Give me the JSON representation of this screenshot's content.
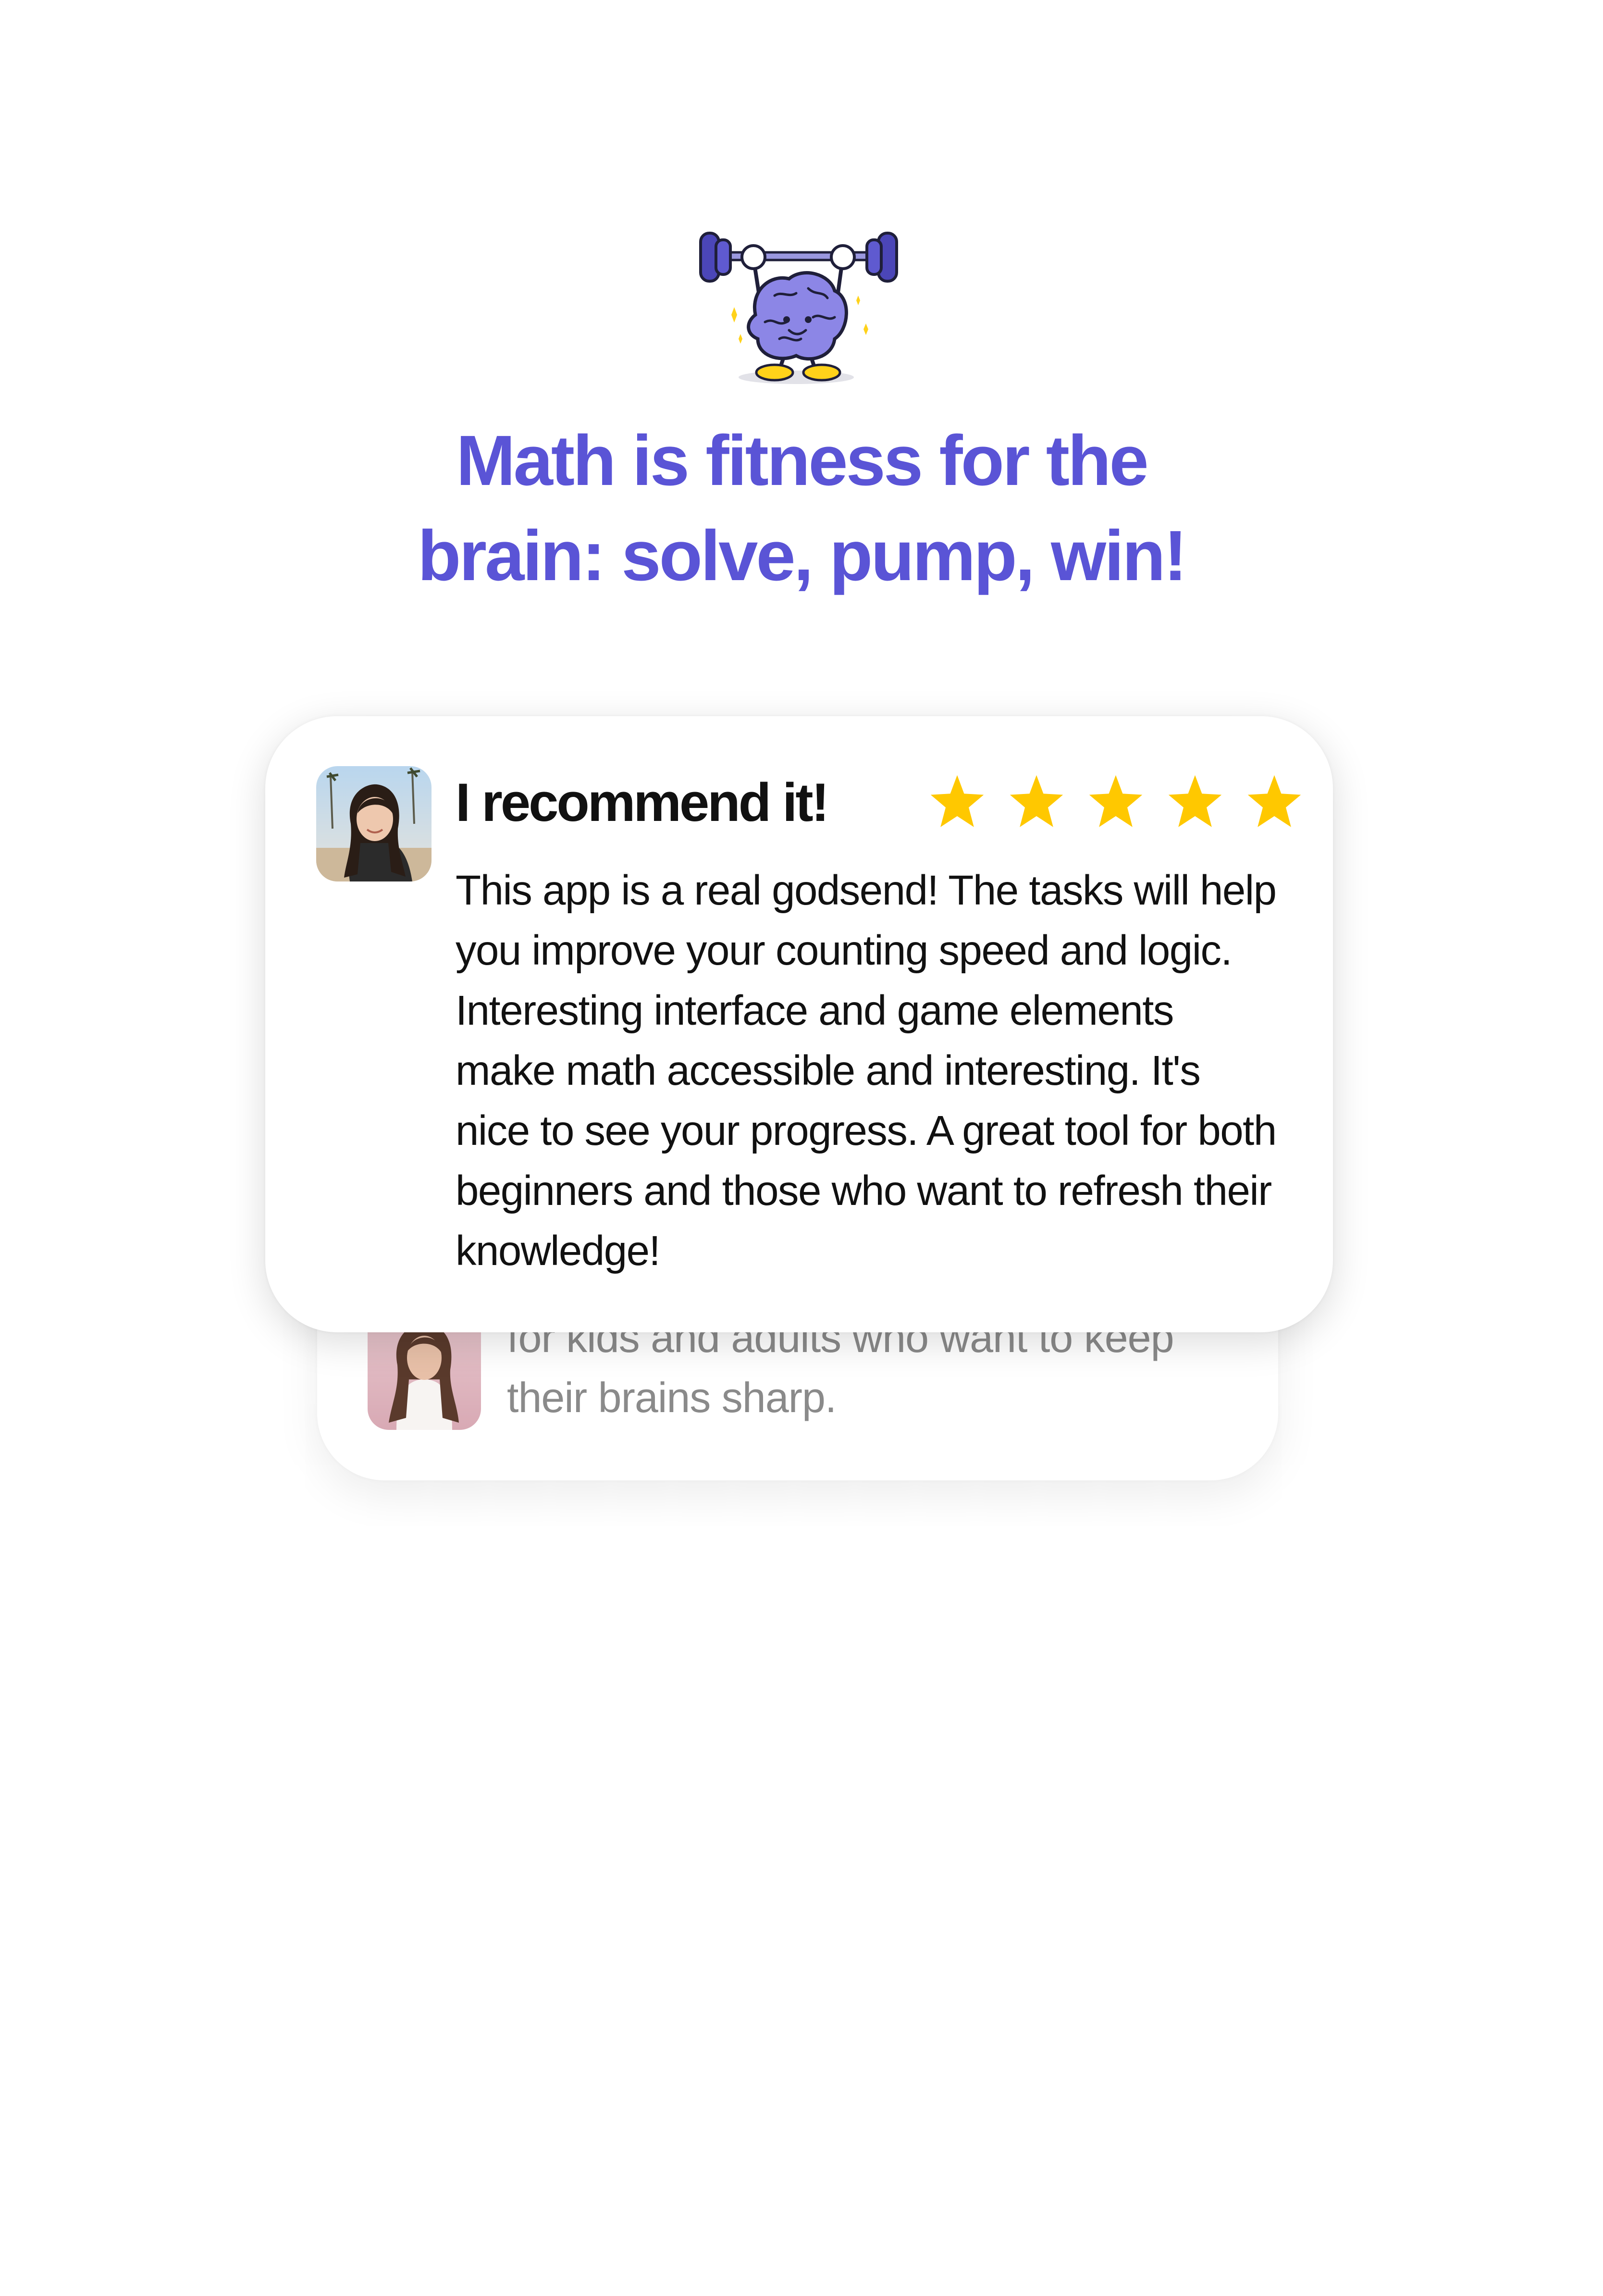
{
  "hero": {
    "mascot_icon": "brain-lifting-barbell-icon",
    "headline_lines": [
      "Math is fitness for the",
      "brain: solve, pump, win!"
    ],
    "headline_color": "#5a54d6"
  },
  "reviews": [
    {
      "title": "I recommend it!",
      "rating": 5,
      "rating_max": 5,
      "star_color": "#ffc800",
      "avatar_icon": "user-avatar",
      "body_lines": [
        "This app is a real godsend! The tasks will help",
        "you improve your counting speed and logic.",
        "Interesting interface and game elements",
        "make math accessible and interesting. It's",
        "nice to see your progress. A great tool for both",
        "beginners and those who want to refresh their",
        "knowledge!"
      ]
    },
    {
      "avatar_icon": "user-avatar",
      "body_lines": [
        "for kids and adults who want to keep",
        "their brains sharp."
      ]
    }
  ]
}
